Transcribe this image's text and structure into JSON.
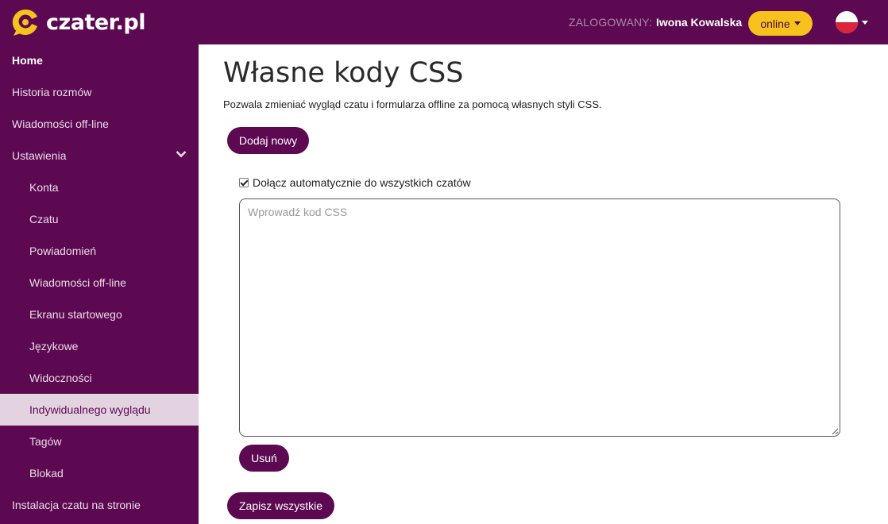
{
  "header": {
    "logo_text": "czater.pl",
    "logged_label": "ZALOGOWANY:",
    "user_name": "Iwona Kowalska",
    "status": "online",
    "language_icon": "poland-flag-icon",
    "colors": {
      "brand": "#5c0952",
      "accent": "#f6c21b"
    }
  },
  "sidebar": {
    "items": [
      {
        "label": "Home"
      },
      {
        "label": "Historia rozmów"
      },
      {
        "label": "Wiadomości off-line"
      },
      {
        "label": "Ustawienia"
      },
      {
        "label": "Konta"
      },
      {
        "label": "Czatu"
      },
      {
        "label": "Powiadomień"
      },
      {
        "label": "Wiadomości off-line"
      },
      {
        "label": "Ekranu startowego"
      },
      {
        "label": "Językowe"
      },
      {
        "label": "Widoczności"
      },
      {
        "label": "Indywidualnego wyglądu"
      },
      {
        "label": "Tagów"
      },
      {
        "label": "Blokad"
      },
      {
        "label": "Instalacja czatu na stronie"
      }
    ],
    "active_label": "Indywidualnego wyglądu"
  },
  "main": {
    "title": "Własne kody CSS",
    "description": "Pozwala zmieniać wygląd czatu i formularza offline za pomocą własnych styli CSS.",
    "add_button": "Dodaj nowy",
    "auto_attach_label": "Dołącz automatycznie do wszystkich czatów",
    "auto_attach_checked": true,
    "css_placeholder": "Wprowadź kod CSS",
    "css_value": "",
    "delete_button": "Usuń",
    "save_all_button": "Zapisz wszystkie"
  }
}
